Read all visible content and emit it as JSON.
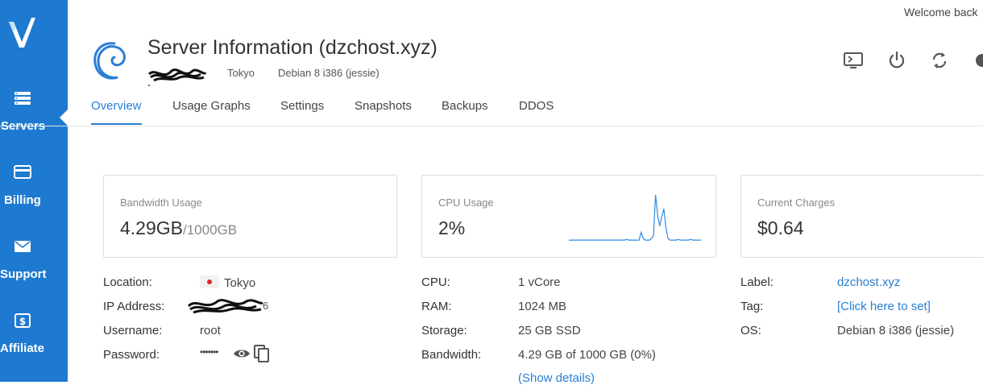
{
  "header": {
    "welcome": "Welcome back",
    "title": "Server Information (dzchost.xyz)",
    "location": "Tokyo",
    "os": "Debian 8 i386 (jessie)"
  },
  "sidebar": {
    "items": [
      {
        "label": "Servers",
        "icon": "servers-icon"
      },
      {
        "label": "Billing",
        "icon": "credit-card-icon"
      },
      {
        "label": "Support",
        "icon": "envelope-icon"
      },
      {
        "label": "Affiliate",
        "icon": "dollar-icon"
      }
    ]
  },
  "actions": [
    "console-icon",
    "power-icon",
    "restart-icon",
    "settings-icon"
  ],
  "tabs": [
    "Overview",
    "Usage Graphs",
    "Settings",
    "Snapshots",
    "Backups",
    "DDOS"
  ],
  "cards": {
    "bandwidth": {
      "label": "Bandwidth Usage",
      "value": "4.29GB",
      "unit": "/1000GB"
    },
    "cpu": {
      "label": "CPU Usage",
      "value": "2%"
    },
    "charges": {
      "label": "Current Charges",
      "value": "$0.64"
    }
  },
  "chart_data": {
    "type": "line",
    "values": [
      1,
      1,
      1,
      1,
      1,
      1,
      1,
      1,
      1,
      1,
      1,
      1,
      1,
      1,
      1,
      1,
      1,
      1,
      1,
      1,
      1,
      1,
      1,
      1,
      1,
      1,
      1,
      1,
      1.5,
      1,
      1,
      1,
      1,
      1,
      1,
      6,
      2,
      1,
      1,
      1,
      2,
      4,
      30,
      17,
      10,
      16,
      21,
      9,
      2,
      1,
      1,
      1,
      1,
      1.5,
      1,
      1,
      1,
      1,
      1,
      1.5,
      1,
      1,
      1,
      1,
      1
    ],
    "ylim": [
      0,
      32
    ],
    "color": "#2f8be0"
  },
  "details": {
    "left": {
      "location_label": "Location:",
      "location_value": "Tokyo",
      "ip_label": "IP Address:",
      "username_label": "Username:",
      "username_value": "root",
      "password_label": "Password:",
      "password_value": "•••••••"
    },
    "middle": {
      "cpu_label": "CPU:",
      "cpu_value": "1 vCore",
      "ram_label": "RAM:",
      "ram_value": "1024 MB",
      "storage_label": "Storage:",
      "storage_value": "25 GB SSD",
      "bandwidth_label": "Bandwidth:",
      "bandwidth_value": "4.29 GB of 1000 GB (0%)",
      "show_details": "(Show details)"
    },
    "right": {
      "label_label": "Label:",
      "label_value": "dzchost.xyz",
      "tag_label": "Tag:",
      "tag_value": "[Click here to set]",
      "os_label": "OS:",
      "os_value": "Debian 8 i386 (jessie)"
    }
  },
  "colors": {
    "sidebar": "#1e7ad0",
    "accent": "#2a7ed3",
    "flag": "#e0242b"
  }
}
